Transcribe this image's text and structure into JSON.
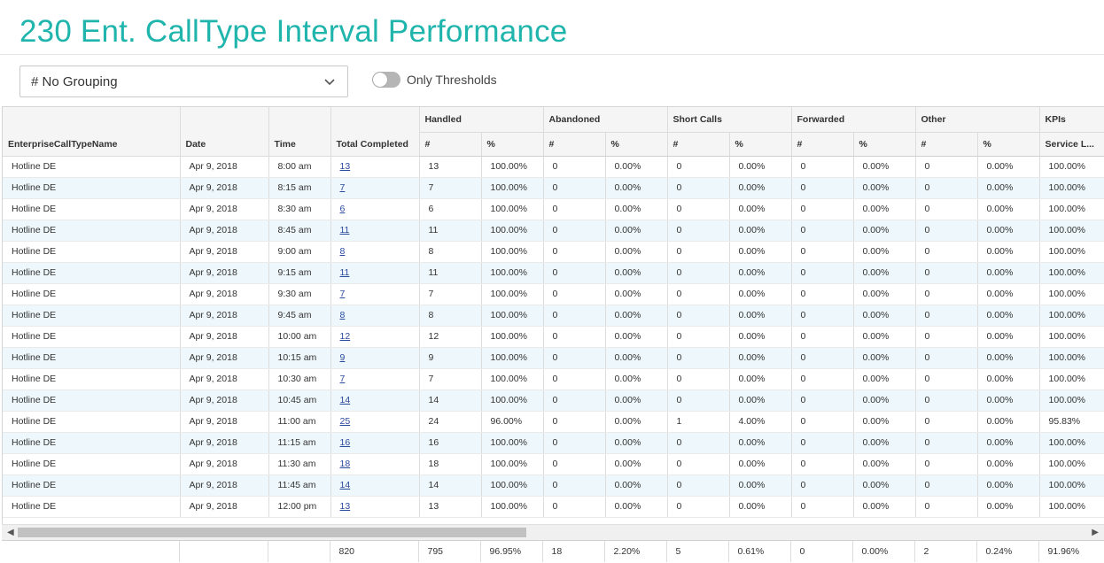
{
  "page": {
    "title": "230 Ent. CallType Interval Performance",
    "accent_color": "#1fb5ad"
  },
  "controls": {
    "grouping_value": "# No Grouping",
    "thresholds_label": "Only Thresholds",
    "thresholds_on": false
  },
  "table": {
    "group_headers": [
      "Handled",
      "Abandoned",
      "Short Calls",
      "Forwarded",
      "Other",
      "KPIs"
    ],
    "columns": [
      "EnterpriseCallTypeName",
      "Date",
      "Time",
      "Total Completed",
      "#",
      "%",
      "#",
      "%",
      "#",
      "%",
      "#",
      "%",
      "#",
      "%",
      "Service L..."
    ],
    "rows": [
      [
        "Hotline DE",
        "Apr 9, 2018",
        "8:00 am",
        "13",
        "13",
        "100.00%",
        "0",
        "0.00%",
        "0",
        "0.00%",
        "0",
        "0.00%",
        "0",
        "0.00%",
        "100.00%"
      ],
      [
        "Hotline DE",
        "Apr 9, 2018",
        "8:15 am",
        "7",
        "7",
        "100.00%",
        "0",
        "0.00%",
        "0",
        "0.00%",
        "0",
        "0.00%",
        "0",
        "0.00%",
        "100.00%"
      ],
      [
        "Hotline DE",
        "Apr 9, 2018",
        "8:30 am",
        "6",
        "6",
        "100.00%",
        "0",
        "0.00%",
        "0",
        "0.00%",
        "0",
        "0.00%",
        "0",
        "0.00%",
        "100.00%"
      ],
      [
        "Hotline DE",
        "Apr 9, 2018",
        "8:45 am",
        "11",
        "11",
        "100.00%",
        "0",
        "0.00%",
        "0",
        "0.00%",
        "0",
        "0.00%",
        "0",
        "0.00%",
        "100.00%"
      ],
      [
        "Hotline DE",
        "Apr 9, 2018",
        "9:00 am",
        "8",
        "8",
        "100.00%",
        "0",
        "0.00%",
        "0",
        "0.00%",
        "0",
        "0.00%",
        "0",
        "0.00%",
        "100.00%"
      ],
      [
        "Hotline DE",
        "Apr 9, 2018",
        "9:15 am",
        "11",
        "11",
        "100.00%",
        "0",
        "0.00%",
        "0",
        "0.00%",
        "0",
        "0.00%",
        "0",
        "0.00%",
        "100.00%"
      ],
      [
        "Hotline DE",
        "Apr 9, 2018",
        "9:30 am",
        "7",
        "7",
        "100.00%",
        "0",
        "0.00%",
        "0",
        "0.00%",
        "0",
        "0.00%",
        "0",
        "0.00%",
        "100.00%"
      ],
      [
        "Hotline DE",
        "Apr 9, 2018",
        "9:45 am",
        "8",
        "8",
        "100.00%",
        "0",
        "0.00%",
        "0",
        "0.00%",
        "0",
        "0.00%",
        "0",
        "0.00%",
        "100.00%"
      ],
      [
        "Hotline DE",
        "Apr 9, 2018",
        "10:00 am",
        "12",
        "12",
        "100.00%",
        "0",
        "0.00%",
        "0",
        "0.00%",
        "0",
        "0.00%",
        "0",
        "0.00%",
        "100.00%"
      ],
      [
        "Hotline DE",
        "Apr 9, 2018",
        "10:15 am",
        "9",
        "9",
        "100.00%",
        "0",
        "0.00%",
        "0",
        "0.00%",
        "0",
        "0.00%",
        "0",
        "0.00%",
        "100.00%"
      ],
      [
        "Hotline DE",
        "Apr 9, 2018",
        "10:30 am",
        "7",
        "7",
        "100.00%",
        "0",
        "0.00%",
        "0",
        "0.00%",
        "0",
        "0.00%",
        "0",
        "0.00%",
        "100.00%"
      ],
      [
        "Hotline DE",
        "Apr 9, 2018",
        "10:45 am",
        "14",
        "14",
        "100.00%",
        "0",
        "0.00%",
        "0",
        "0.00%",
        "0",
        "0.00%",
        "0",
        "0.00%",
        "100.00%"
      ],
      [
        "Hotline DE",
        "Apr 9, 2018",
        "11:00 am",
        "25",
        "24",
        "96.00%",
        "0",
        "0.00%",
        "1",
        "4.00%",
        "0",
        "0.00%",
        "0",
        "0.00%",
        "95.83%"
      ],
      [
        "Hotline DE",
        "Apr 9, 2018",
        "11:15 am",
        "16",
        "16",
        "100.00%",
        "0",
        "0.00%",
        "0",
        "0.00%",
        "0",
        "0.00%",
        "0",
        "0.00%",
        "100.00%"
      ],
      [
        "Hotline DE",
        "Apr 9, 2018",
        "11:30 am",
        "18",
        "18",
        "100.00%",
        "0",
        "0.00%",
        "0",
        "0.00%",
        "0",
        "0.00%",
        "0",
        "0.00%",
        "100.00%"
      ],
      [
        "Hotline DE",
        "Apr 9, 2018",
        "11:45 am",
        "14",
        "14",
        "100.00%",
        "0",
        "0.00%",
        "0",
        "0.00%",
        "0",
        "0.00%",
        "0",
        "0.00%",
        "100.00%"
      ],
      [
        "Hotline DE",
        "Apr 9, 2018",
        "12:00 pm",
        "13",
        "13",
        "100.00%",
        "0",
        "0.00%",
        "0",
        "0.00%",
        "0",
        "0.00%",
        "0",
        "0.00%",
        "100.00%"
      ]
    ],
    "totals": [
      "",
      "",
      "",
      "820",
      "795",
      "96.95%",
      "18",
      "2.20%",
      "5",
      "0.61%",
      "0",
      "0.00%",
      "2",
      "0.24%",
      "91.96%"
    ]
  }
}
